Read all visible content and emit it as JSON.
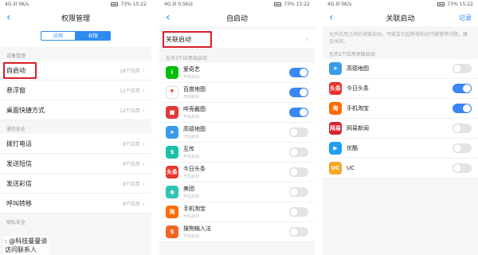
{
  "screens": [
    {
      "status": {
        "left": "4G.ill 0K/s",
        "right": "73% 15:22"
      },
      "title": "权限管理",
      "segments": [
        "应用",
        "权限"
      ],
      "section1": "设备管理",
      "rows1": [
        {
          "label": "自启动",
          "meta": "18个应用"
        },
        {
          "label": "悬浮窗",
          "meta": "12个应用"
        },
        {
          "label": "桌面快捷方式",
          "meta": "12个应用"
        }
      ],
      "section2": "通信安全",
      "rows2": [
        {
          "label": "拨打电话",
          "meta": "9个应用"
        },
        {
          "label": "发送短信",
          "meta": "9个应用"
        },
        {
          "label": "发送彩信",
          "meta": "9个应用"
        },
        {
          "label": "呼叫转移",
          "meta": "9个应用"
        }
      ],
      "section3": "隐私安全",
      "watermark": ": @科技曼曼谈",
      "tail": "访问联系人"
    },
    {
      "status": {
        "left": "4G.ill 0.5K/s",
        "right": "73% 15:22"
      },
      "title": "自启动",
      "link_row": "关联启动",
      "section": "允许3个应用自启动",
      "apps": [
        {
          "name": "爱奇艺",
          "sub": "开机启动",
          "on": true,
          "icon": "iqiyi-icon",
          "color": "#00be06",
          "glyph": "i"
        },
        {
          "name": "百度地图",
          "sub": "开机启动",
          "on": true,
          "icon": "baidu-map-icon",
          "color": "#ffffff",
          "glyph": "📍"
        },
        {
          "name": "哔壳截图",
          "sub": "开机启动",
          "on": true,
          "icon": "screenshot-app-icon",
          "color": "#e03a3a",
          "glyph": "■"
        },
        {
          "name": "高德地图",
          "sub": "开机启动",
          "on": false,
          "icon": "amap-icon",
          "color": "#3a9be8",
          "glyph": "➤"
        },
        {
          "name": "互传",
          "sub": "开机启动",
          "on": false,
          "icon": "share-app-icon",
          "color": "#19c2a6",
          "glyph": "S"
        },
        {
          "name": "今日头条",
          "sub": "开机启动",
          "on": false,
          "icon": "toutiao-icon",
          "color": "#e8342c",
          "glyph": "头条"
        },
        {
          "name": "美团",
          "sub": "开机启动",
          "on": false,
          "icon": "meituan-icon",
          "color": "#2fc4b0",
          "glyph": "◉"
        },
        {
          "name": "手机淘宝",
          "sub": "开机启动",
          "on": false,
          "icon": "taobao-icon",
          "color": "#ff6a00",
          "glyph": "淘"
        },
        {
          "name": "搜狗输入法",
          "sub": "开机启动",
          "on": false,
          "icon": "sogou-icon",
          "color": "#f26522",
          "glyph": "S"
        }
      ]
    },
    {
      "status": {
        "left": "4G.ill 0K/s",
        "right": "73% 15:22"
      },
      "title": "关联启动",
      "right_action": "记录",
      "desc": "允许应用之间的关联启动，可能会引起耗电和运行缓慢等问题，建议关闭。",
      "section": "允许2个应用关联启动",
      "apps": [
        {
          "name": "高德地图",
          "on": false,
          "icon": "amap-icon",
          "color": "#3a9be8",
          "glyph": "➤"
        },
        {
          "name": "今日头条",
          "on": true,
          "icon": "toutiao-icon",
          "color": "#e8342c",
          "glyph": "头条"
        },
        {
          "name": "手机淘宝",
          "on": true,
          "icon": "taobao-icon",
          "color": "#ff6a00",
          "glyph": "淘"
        },
        {
          "name": "网易新闻",
          "on": false,
          "icon": "netease-news-icon",
          "color": "#d8202e",
          "glyph": "网易"
        },
        {
          "name": "优酷",
          "on": false,
          "icon": "youku-icon",
          "color": "#1e9ff2",
          "glyph": "▶"
        },
        {
          "name": "UC",
          "on": false,
          "icon": "uc-browser-icon",
          "color": "#f5a623",
          "glyph": "UC"
        }
      ]
    }
  ]
}
